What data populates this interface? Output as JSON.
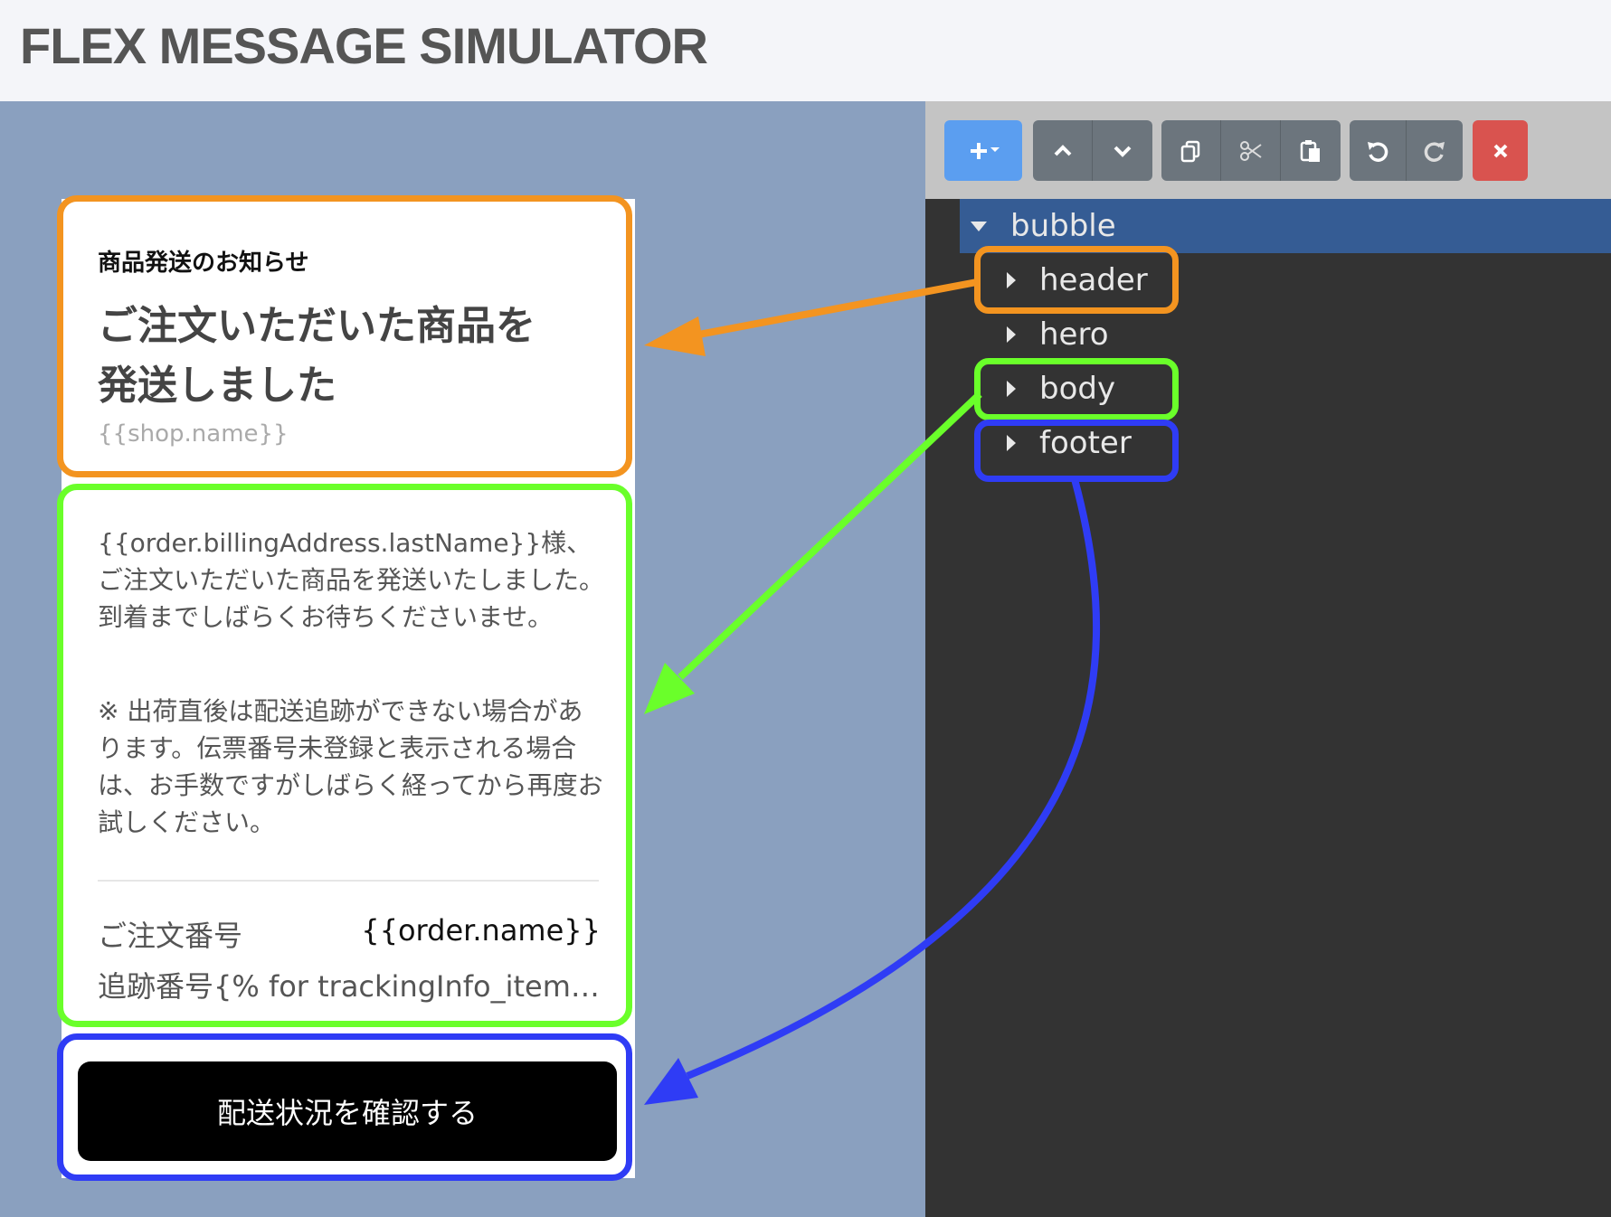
{
  "app": {
    "title": "FLEX MESSAGE SIMULATOR"
  },
  "toolbar": {
    "buttons": [
      {
        "name": "add-button",
        "icon": "plus-caret-icon"
      },
      {
        "name": "move-up-button",
        "icon": "chevron-up-icon"
      },
      {
        "name": "move-down-button",
        "icon": "chevron-down-icon"
      },
      {
        "name": "copy-button",
        "icon": "copy-icon"
      },
      {
        "name": "cut-button",
        "icon": "scissors-icon"
      },
      {
        "name": "paste-button",
        "icon": "paste-icon"
      },
      {
        "name": "undo-button",
        "icon": "undo-icon"
      },
      {
        "name": "redo-button",
        "icon": "redo-icon"
      },
      {
        "name": "delete-button",
        "icon": "close-icon"
      }
    ]
  },
  "tree": {
    "root": {
      "label": "bubble",
      "expanded": true,
      "selected": true
    },
    "children": [
      {
        "label": "header"
      },
      {
        "label": "hero"
      },
      {
        "label": "body"
      },
      {
        "label": "footer"
      }
    ]
  },
  "preview": {
    "header": {
      "subtitle": "商品発送のお知らせ",
      "title": "ご注文いただいた商品を発送しました",
      "shop": "{{shop.name}}"
    },
    "body": {
      "paragraph1": "{{order.billingAddress.lastName}}様、ご注文いただいた商品を発送いたしました。到着までしばらくお待ちくださいませ。",
      "paragraph2": "※ 出荷直後は配送追跡ができない場合があります。伝票番号未登録と表示される場合は、お手数ですがしばらく経ってから再度お試しください。",
      "order_label": "ご注文番号",
      "order_value": "{{order.name}}",
      "tracking_text": "追跡番号{% for trackingInfo_item i..."
    },
    "footer": {
      "button_label": "配送状況を確認する"
    }
  },
  "colors": {
    "header_outline": "#f39420",
    "body_outline": "#6aff2a",
    "footer_outline": "#2f3cf5",
    "preview_bg": "#8aa0bf",
    "editor_bg": "#333333",
    "tree_selected": "#355c94",
    "primary_button": "#5b9ef0",
    "danger_button": "#d9534f"
  }
}
